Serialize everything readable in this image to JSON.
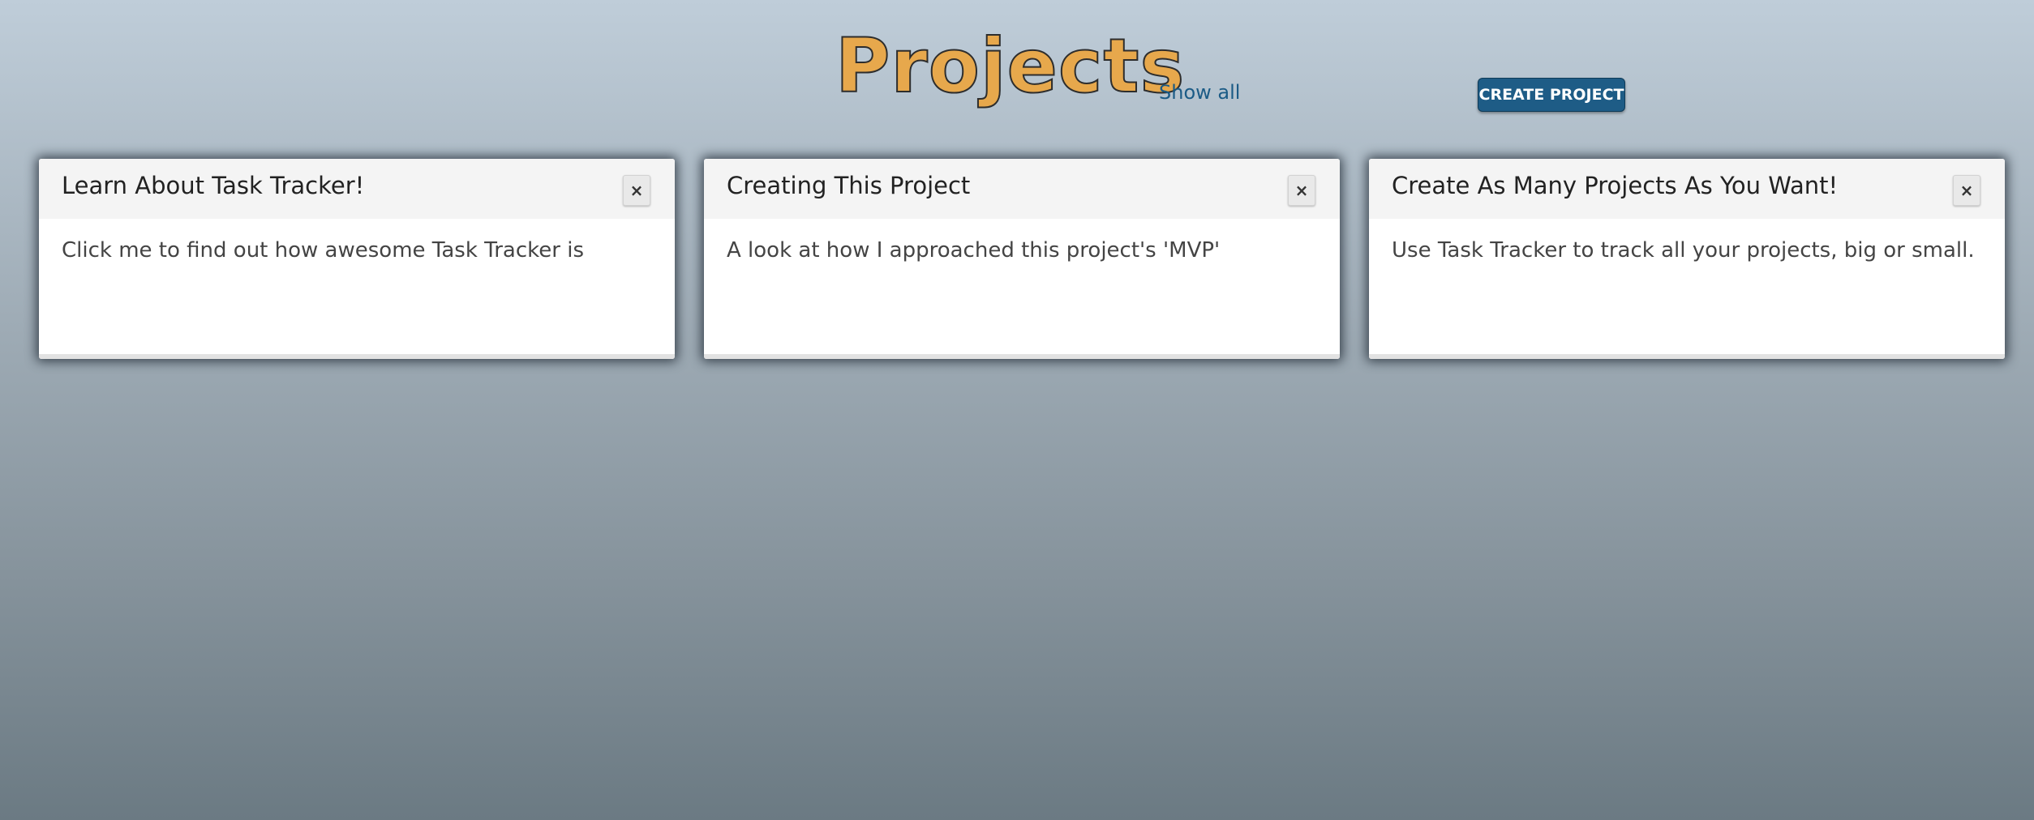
{
  "header": {
    "title": "Projects",
    "show_all_label": "Show all",
    "create_label": "CREATE PROJECT"
  },
  "colors": {
    "title": "#e7a84c",
    "link": "#1b5b86",
    "button": "#1e5c86"
  },
  "cards": [
    {
      "title": "Learn About Task Tracker!",
      "body": "Click me to find out how awesome Task Tracker is",
      "close_icon": "close-icon",
      "close_label": "×"
    },
    {
      "title": "Creating This Project",
      "body": "A look at how I approached this project's 'MVP'",
      "close_icon": "close-icon",
      "close_label": "×"
    },
    {
      "title": "Create As Many Projects As You Want!",
      "body": "Use Task Tracker to track all your projects, big or small.",
      "close_icon": "close-icon",
      "close_label": "×"
    }
  ]
}
